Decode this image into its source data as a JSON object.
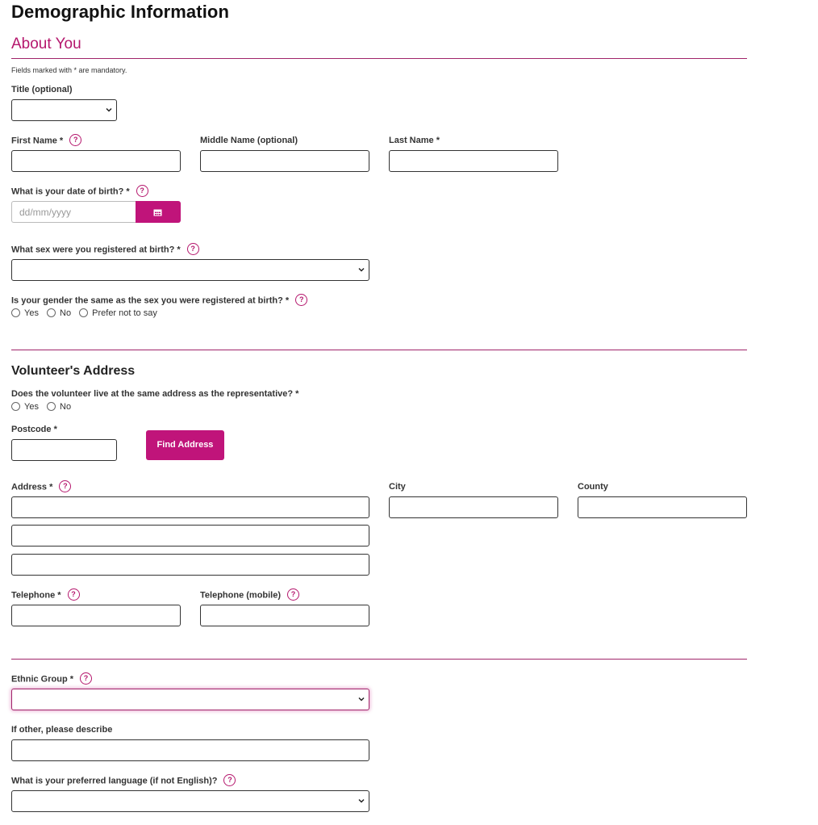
{
  "page_title": "Demographic Information",
  "about": {
    "title": "About You",
    "mandatory_note": "Fields marked with * are mandatory.",
    "title_label": "Title (optional)",
    "first_name_label": "First Name *",
    "middle_name_label": "Middle Name (optional)",
    "last_name_label": "Last Name *",
    "dob_label": "What is your date of birth? *",
    "dob_placeholder": "dd/mm/yyyy",
    "sex_label": "What sex were you registered at birth? *",
    "gender_label": "Is your gender the same as the sex you were registered at birth? *",
    "gender_options": [
      "Yes",
      "No",
      "Prefer not to say"
    ]
  },
  "address": {
    "title": "Volunteer's Address",
    "same_address_label": "Does the volunteer live at the same address as the representative? *",
    "same_address_options": [
      "Yes",
      "No"
    ],
    "postcode_label": "Postcode *",
    "find_address_button": "Find Address",
    "address_label": "Address *",
    "city_label": "City",
    "county_label": "County",
    "telephone_label": "Telephone *",
    "mobile_label": "Telephone (mobile)"
  },
  "ethnicity": {
    "ethnic_group_label": "Ethnic Group *",
    "other_label": "If other, please describe",
    "language_label": "What is your preferred language (if not English)?"
  },
  "help_glyph": "?",
  "colors": {
    "accent": "#c0147a",
    "rule": "#a0246a",
    "section_title": "#b5176d"
  },
  "icons": {
    "help": "question-circle-icon",
    "calendar": "calendar-icon",
    "select": "chevron-down-icon"
  }
}
